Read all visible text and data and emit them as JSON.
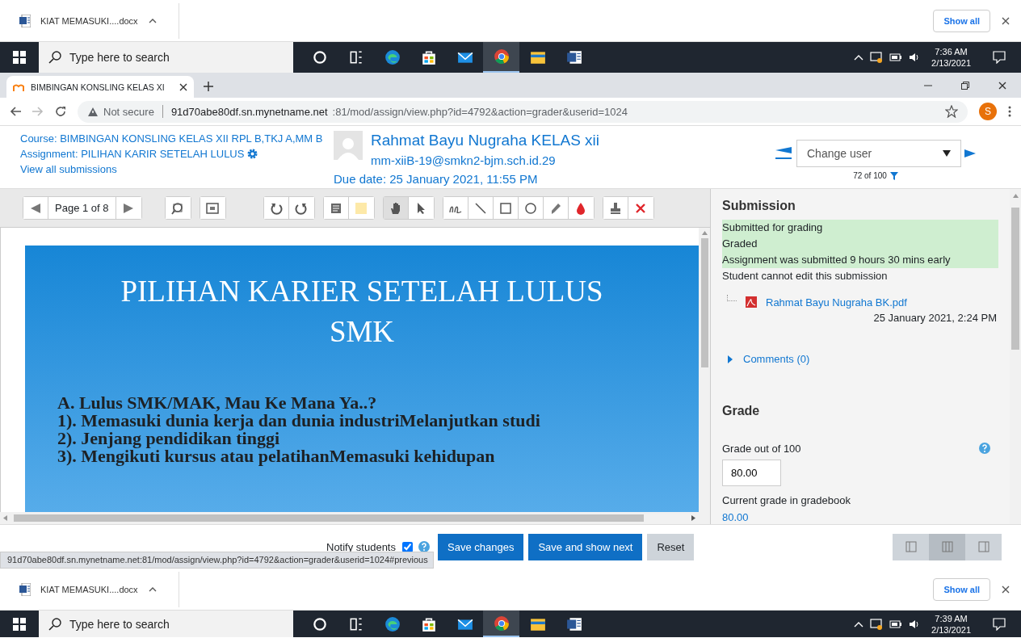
{
  "download_bar_top": {
    "file": "KIAT MEMASUKI....docx",
    "show_all": "Show all"
  },
  "taskbar_top": {
    "search_placeholder": "Type here to search",
    "apps": [
      {
        "kind": "cortana",
        "selected": false
      },
      {
        "kind": "taskview",
        "selected": false
      },
      {
        "kind": "edge",
        "selected": false
      },
      {
        "kind": "store",
        "selected": false
      },
      {
        "kind": "mail",
        "selected": false
      },
      {
        "kind": "chrome",
        "selected": true
      },
      {
        "kind": "explorer",
        "selected": false
      },
      {
        "kind": "word",
        "selected": false
      }
    ],
    "time": "7:36 AM",
    "date": "2/13/2021"
  },
  "browser": {
    "tab_title": "BIMBINGAN KONSLING KELAS XI",
    "security": "Not secure",
    "url_host": "91d70abe80df.sn.mynetname.net",
    "url_rest": ":81/mod/assign/view.php?id=4792&action=grader&userid=1024",
    "profile": "S"
  },
  "header": {
    "course": "Course: BIMBINGAN KONSLING KELAS XII RPL B,TKJ A,MM B",
    "assignment": "Assignment: PILIHAN KARIR SETELAH LULUS",
    "view_all": "View all submissions",
    "user_name": "Rahmat Bayu Nugraha KELAS xii",
    "user_email": "mm-xiiB-19@smkn2-bjm.sch.id.29",
    "due_date": "Due date: 25 January 2021, 11:55 PM",
    "change_user_placeholder": "Change user",
    "count": "72 of 100"
  },
  "toolbar": {
    "page": "Page 1 of 8",
    "groups": [
      [
        {
          "kind": "search",
          "selected": false
        }
      ],
      [
        {
          "kind": "expand",
          "selected": false
        }
      ],
      [
        {
          "kind": "rotate-left",
          "selected": false
        },
        {
          "kind": "rotate-right",
          "selected": false
        }
      ],
      [
        {
          "kind": "comment",
          "selected": false
        },
        {
          "kind": "color",
          "selected": false
        }
      ],
      [
        {
          "kind": "hand",
          "selected": true
        },
        {
          "kind": "select",
          "selected": false
        }
      ],
      [
        {
          "kind": "pen",
          "selected": false
        },
        {
          "kind": "line",
          "selected": false
        },
        {
          "kind": "rectangle",
          "selected": false
        },
        {
          "kind": "oval",
          "selected": false
        },
        {
          "kind": "highlight",
          "selected": false
        },
        {
          "kind": "drop",
          "selected": false
        }
      ],
      [
        {
          "kind": "stamp",
          "selected": false
        },
        {
          "kind": "delete",
          "selected": false
        }
      ]
    ]
  },
  "slide": {
    "title": "PILIHAN KARIER SETELAH LULUS SMK",
    "lines": [
      "A. Lulus SMK/MAK, Mau Ke Mana Ya..?",
      "1). Memasuki dunia kerja dan dunia industriMelanjutkan studi",
      "2). Jenjang pendidikan tinggi",
      "3). Mengikuti kursus atau pelatihanMemasuki kehidupan"
    ]
  },
  "submission": {
    "heading": "Submission",
    "statuses": [
      {
        "text": "Submitted for grading",
        "highlighted": true
      },
      {
        "text": "Graded",
        "highlighted": true
      },
      {
        "text": "Assignment was submitted 9 hours 30 mins early",
        "highlighted": true
      },
      {
        "text": "Student cannot edit this submission",
        "highlighted": false
      }
    ],
    "file_name": "Rahmat Bayu Nugraha BK.pdf",
    "file_date": "25 January 2021, 2:24 PM",
    "comments": {
      "label": "Comments (0)",
      "expanded": false
    }
  },
  "grade": {
    "heading": "Grade",
    "label": "Grade out of 100",
    "value": "80.00",
    "current_label": "Current grade in gradebook",
    "current_value": "80.00"
  },
  "footer": {
    "notify_label": "Notify students",
    "notify_checked": true,
    "buttons": [
      {
        "label": "Save changes",
        "kind": "primary"
      },
      {
        "label": "Save and show next",
        "kind": "primary"
      },
      {
        "label": "Reset",
        "kind": "secondary"
      }
    ],
    "layouts": [
      {
        "kind": "left",
        "selected": false
      },
      {
        "kind": "both",
        "selected": true
      },
      {
        "kind": "right",
        "selected": false
      }
    ],
    "status_url": "91d70abe80df.sn.mynetname.net:81/mod/assign/view.php?id=4792&action=grader&userid=1024#previous"
  },
  "download_bar_bottom": {
    "file": "KIAT MEMASUKI....docx",
    "show_all": "Show all"
  },
  "taskbar_bottom": {
    "search_placeholder": "Type here to search",
    "apps": [
      {
        "kind": "cortana",
        "selected": false
      },
      {
        "kind": "taskview",
        "selected": false
      },
      {
        "kind": "edge",
        "selected": false
      },
      {
        "kind": "store",
        "selected": false
      },
      {
        "kind": "mail",
        "selected": false
      },
      {
        "kind": "chrome",
        "selected": true
      },
      {
        "kind": "explorer",
        "selected": false
      },
      {
        "kind": "word",
        "selected": false
      }
    ],
    "time": "7:39 AM",
    "date": "2/13/2021"
  }
}
